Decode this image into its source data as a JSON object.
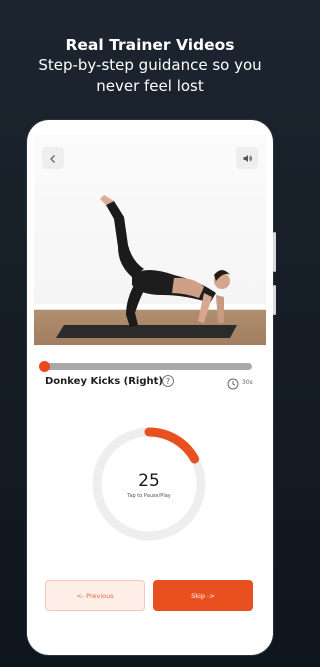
{
  "promo": {
    "title": "Real Trainer Videos",
    "subtitle_line1": "Step-by-step guidance so you",
    "subtitle_line2": "never feel lost"
  },
  "video": {
    "back_icon": "chevron-left-icon",
    "sound_icon": "speaker-icon",
    "progress": 0.0
  },
  "exercise": {
    "name": "Donkey Kicks (Right)",
    "help_glyph": "?",
    "duration": "30s",
    "duration_icon": "clock-icon"
  },
  "timer": {
    "count": "25",
    "hint": "Tap to Pause/Play",
    "remaining_fraction": 0.17
  },
  "controls": {
    "previous_label": "<- Previous",
    "skip_label": "Skip ->"
  },
  "colors": {
    "accent": "#e8511f",
    "track": "#a9a9a9",
    "ring_bg": "#eeeeee"
  }
}
